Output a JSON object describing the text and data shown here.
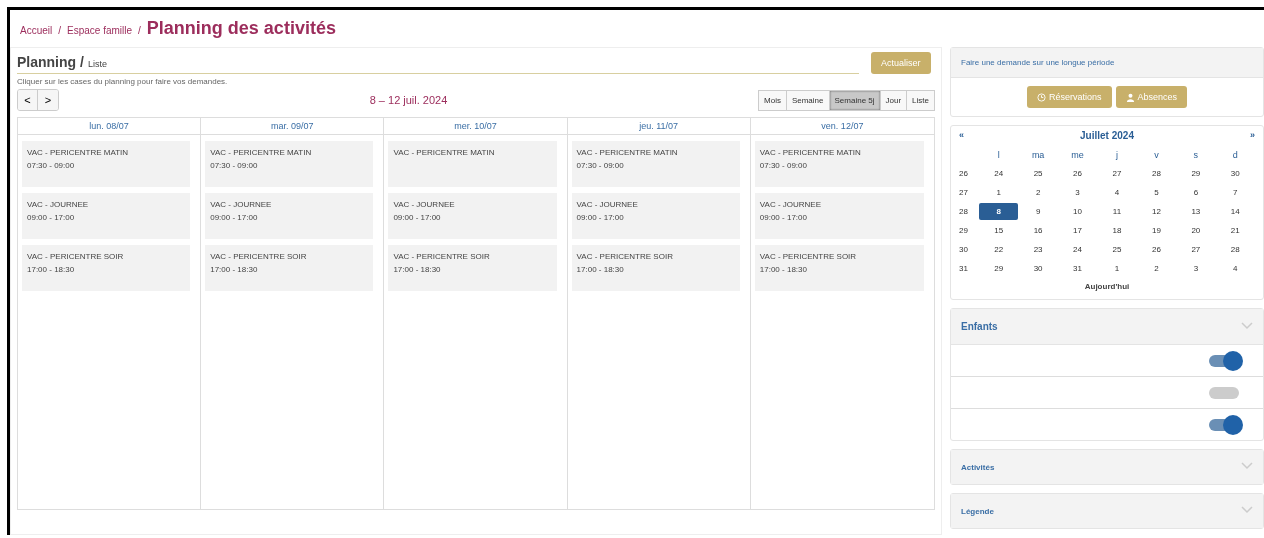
{
  "breadcrumb": [
    "Accueil",
    "/",
    "Espace famille",
    "/"
  ],
  "page_title": "Planning des activités",
  "planning": {
    "title": "Planning /",
    "subtitle": "Liste",
    "refresh_button": "Actualiser",
    "hint": "Cliquer sur les cases du planning pour faire vos demandes.",
    "prev": "<",
    "next": ">",
    "range": "8 – 12 juil. 2024",
    "views": [
      {
        "label": "Mois",
        "selected": false
      },
      {
        "label": "Semaine",
        "selected": false
      },
      {
        "label": "Semaine 5j",
        "selected": true
      },
      {
        "label": "Jour",
        "selected": false
      },
      {
        "label": "Liste",
        "selected": false
      }
    ],
    "days": [
      {
        "label": "lun. 08/07",
        "events": [
          {
            "title": "VAC - PERICENTRE MATIN",
            "time": "07:30 - 09:00"
          },
          {
            "title": "VAC - JOURNEE",
            "time": "09:00 - 17:00"
          },
          {
            "title": "VAC - PERICENTRE SOIR",
            "time": "17:00 - 18:30"
          }
        ]
      },
      {
        "label": "mar. 09/07",
        "events": [
          {
            "title": "VAC - PERICENTRE MATIN",
            "time": "07:30 - 09:00"
          },
          {
            "title": "VAC - JOURNEE",
            "time": "09:00 - 17:00"
          },
          {
            "title": "VAC - PERICENTRE SOIR",
            "time": "17:00 - 18:30"
          }
        ]
      },
      {
        "label": "mer. 10/07",
        "events": [
          {
            "title": "VAC - PERICENTRE MATIN"
          },
          {
            "title": "VAC - JOURNEE",
            "time": "09:00 - 17:00"
          },
          {
            "title": "VAC - PERICENTRE SOIR",
            "time": "17:00 - 18:30"
          }
        ]
      },
      {
        "label": "jeu. 11/07",
        "events": [
          {
            "title": "VAC - PERICENTRE MATIN",
            "time": "07:30 - 09:00"
          },
          {
            "title": "VAC - JOURNEE",
            "time": "09:00 - 17:00"
          },
          {
            "title": "VAC - PERICENTRE SOIR",
            "time": "17:00 - 18:30"
          }
        ]
      },
      {
        "label": "ven. 12/07",
        "events": [
          {
            "title": "VAC - PERICENTRE MATIN",
            "time": "07:30 - 09:00"
          },
          {
            "title": "VAC - JOURNEE",
            "time": "09:00 - 17:00"
          },
          {
            "title": "VAC - PERICENTRE SOIR",
            "time": "17:00 - 18:30"
          }
        ]
      }
    ]
  },
  "long_request": {
    "title": "Faire une demande sur une longue période",
    "buttons": [
      {
        "label": "Réservations",
        "kind": "clock"
      },
      {
        "label": "Absences",
        "kind": "person"
      }
    ]
  },
  "mini_calendar": {
    "prev": "«",
    "title": "Juillet 2024",
    "next": "»",
    "weekdays": [
      "l",
      "ma",
      "me",
      "j",
      "v",
      "s",
      "d"
    ],
    "weeks": [
      {
        "number": "26",
        "days": [
          {
            "label": "24",
            "selected": false
          },
          {
            "label": "25",
            "selected": false
          },
          {
            "label": "26",
            "selected": false
          },
          {
            "label": "27",
            "selected": false
          },
          {
            "label": "28",
            "selected": false
          },
          {
            "label": "29",
            "selected": false
          },
          {
            "label": "30",
            "selected": false
          }
        ]
      },
      {
        "number": "27",
        "days": [
          {
            "label": "1",
            "selected": false
          },
          {
            "label": "2",
            "selected": false
          },
          {
            "label": "3",
            "selected": false
          },
          {
            "label": "4",
            "selected": false
          },
          {
            "label": "5",
            "selected": false
          },
          {
            "label": "6",
            "selected": false
          },
          {
            "label": "7",
            "selected": false
          }
        ]
      },
      {
        "number": "28",
        "days": [
          {
            "label": "8",
            "selected": true
          },
          {
            "label": "9",
            "selected": false
          },
          {
            "label": "10",
            "selected": false
          },
          {
            "label": "11",
            "selected": false
          },
          {
            "label": "12",
            "selected": false
          },
          {
            "label": "13",
            "selected": false
          },
          {
            "label": "14",
            "selected": false
          }
        ]
      },
      {
        "number": "29",
        "days": [
          {
            "label": "15",
            "selected": false
          },
          {
            "label": "16",
            "selected": false
          },
          {
            "label": "17",
            "selected": false
          },
          {
            "label": "18",
            "selected": false
          },
          {
            "label": "19",
            "selected": false
          },
          {
            "label": "20",
            "selected": false
          },
          {
            "label": "21",
            "selected": false
          }
        ]
      },
      {
        "number": "30",
        "days": [
          {
            "label": "22",
            "selected": false
          },
          {
            "label": "23",
            "selected": false
          },
          {
            "label": "24",
            "selected": false
          },
          {
            "label": "25",
            "selected": false
          },
          {
            "label": "26",
            "selected": false
          },
          {
            "label": "27",
            "selected": false
          },
          {
            "label": "28",
            "selected": false
          }
        ]
      },
      {
        "number": "31",
        "days": [
          {
            "label": "29",
            "selected": false
          },
          {
            "label": "30",
            "selected": false
          },
          {
            "label": "31",
            "selected": false
          },
          {
            "label": "1",
            "selected": false
          },
          {
            "label": "2",
            "selected": false
          },
          {
            "label": "3",
            "selected": false
          },
          {
            "label": "4",
            "selected": false
          }
        ]
      }
    ],
    "today": "Aujourd'hui"
  },
  "children_panel": {
    "title": "Enfants",
    "expanded": true,
    "toggles": [
      {
        "on": true
      },
      {
        "on": false
      },
      {
        "on": true
      }
    ]
  },
  "panels": [
    {
      "title": "Activités",
      "expanded": false
    },
    {
      "title": "Légende",
      "expanded": false
    }
  ]
}
